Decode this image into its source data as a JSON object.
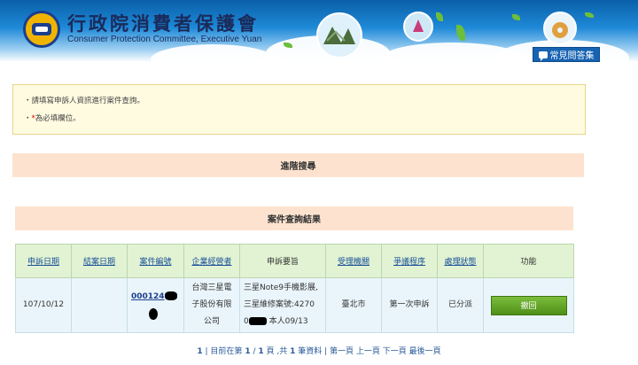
{
  "header": {
    "title_zh": "行政院消費者保護會",
    "title_en": "Consumer Protection Committee, Executive Yuan",
    "faq_label": "常見問答集"
  },
  "notice": {
    "line1": "・請填寫申訴人資訊進行案件查詢。",
    "line2_prefix": "・",
    "line2_required": "*",
    "line2_text": "為必填欄位。"
  },
  "advanced_search_label": "進階搜尋",
  "results_title": "案件查詢結果",
  "table": {
    "headers": [
      "申訴日期",
      "結案日期",
      "案件編號",
      "企業經營者",
      "申訴要旨",
      "受理機關",
      "爭議程序",
      "處理狀態",
      "功能"
    ],
    "row": {
      "complaint_date": "107/10/12",
      "close_date": "",
      "case_number": "000124",
      "company_line1": "台灣三星電",
      "company_line2": "子股份有限",
      "company_line3": "公司",
      "summary_line1": "三星Note9手機影展,",
      "summary_line2": "三星維修案號:4270",
      "summary_line3_prefix": "0",
      "summary_line3_suffix": "本人09/13",
      "agency": "臺北市",
      "procedure": "第一次申訴",
      "status": "已分派",
      "action_label": "撤回"
    }
  },
  "pager": {
    "current": "1",
    "text1": "| 目前在第",
    "page": "1",
    "sep": "/",
    "total_pages": "1",
    "text2": "頁 ,共",
    "count": "1",
    "text3": "筆資料 | 第一頁 上一頁 下一頁 最後一頁"
  }
}
